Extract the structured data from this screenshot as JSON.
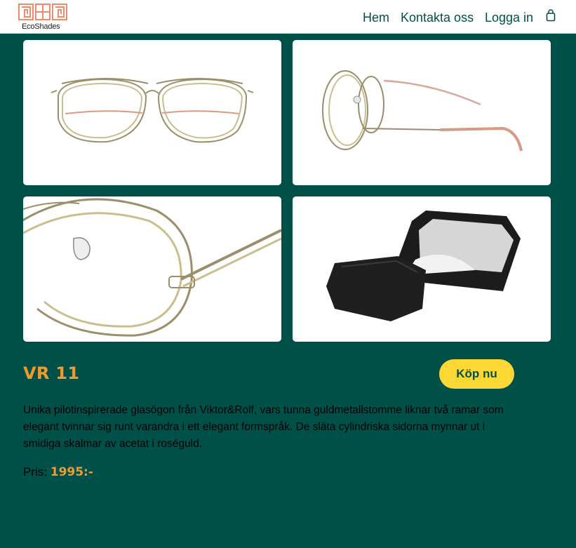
{
  "header": {
    "logo_text": "EcoShades",
    "nav": {
      "home": "Hem",
      "contact": "Kontakta oss",
      "login": "Logga in"
    },
    "cart_icon": "shopping-bag-icon"
  },
  "gallery": {
    "images": [
      {
        "name": "front-view"
      },
      {
        "name": "side-view"
      },
      {
        "name": "closeup-view"
      },
      {
        "name": "case-view"
      }
    ]
  },
  "product": {
    "title": "VR 11",
    "buy_label": "Köp nu",
    "description": "Unika pilotinspirerade glasögon från Viktor&Rolf, vars tunna guldmetallstomme liknar två ramar som elegant tvinnar sig runt varandra i ett elegant formspråk. De släta cylindriska sidorna mynnar ut i smidiga skalmar av acetat i roséguld.",
    "price_label": "Pris:",
    "price_value": "1995:-"
  },
  "colors": {
    "background": "#00504a",
    "accent_orange": "#f39a2e",
    "button_yellow": "#fdd835",
    "logo_salmon": "#f08a6a"
  }
}
